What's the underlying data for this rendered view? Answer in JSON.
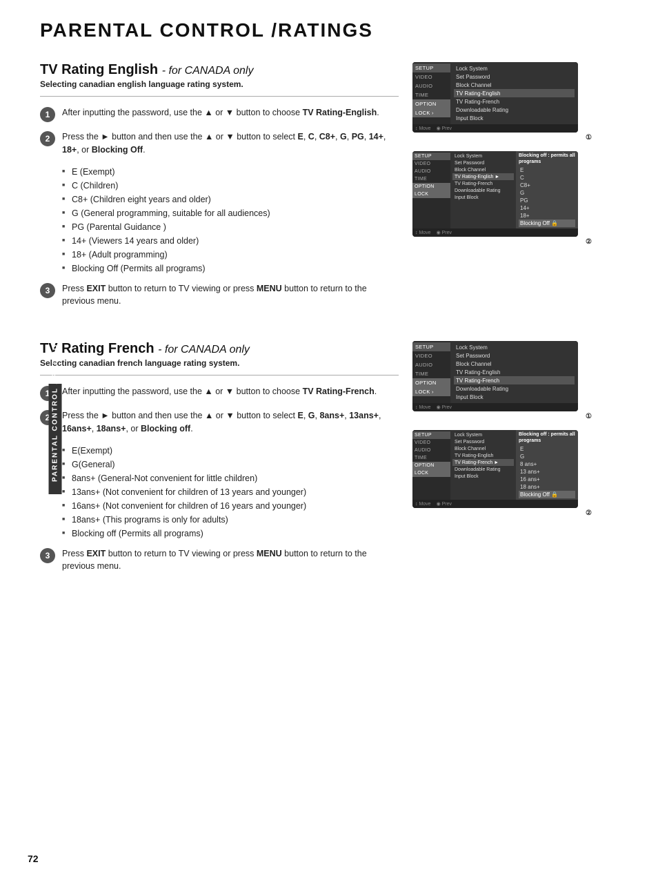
{
  "page": {
    "title": "PARENTAL CONTROL /RATINGS",
    "number": "72",
    "side_tab": "PARENTAL CONTROL / RATING"
  },
  "section1": {
    "title": "TV Rating English",
    "subtitle_italic": "- for CANADA only",
    "subtitle2": "Selecting canadian english language rating system.",
    "steps": [
      {
        "number": "1",
        "text": "After inputting the password, use the ▲ or ▼ button to choose TV Rating-English."
      },
      {
        "number": "2",
        "text": "Press the ► button and then use the ▲ or ▼ button to select E, C, C8+, G, PG, 14+, 18+, or Blocking Off."
      },
      {
        "number": "3",
        "text": "Press EXIT button to return to TV viewing or press MENU button to return to the previous menu."
      }
    ],
    "bullets": [
      "E (Exempt)",
      "C (Children)",
      "C8+ (Children eight years and older)",
      "G (General programming, suitable for all audiences)",
      "PG (Parental Guidance )",
      "14+ (Viewers 14 years and older)",
      "18+ (Adult programming)",
      "Blocking Off (Permits all programs)"
    ],
    "screen1": {
      "sidebar_items": [
        "SETUP",
        "VIDEO",
        "AUDIO",
        "TIME",
        "OPTION",
        "LOCK"
      ],
      "active_sidebar": "LOCK",
      "menu_items": [
        "Lock System",
        "Set Password",
        "Block Channel",
        "TV Rating-English",
        "TV Rating-French",
        "Downloadable Rating",
        "Input Block"
      ],
      "selected_menu": "TV Rating-English",
      "footer": [
        "↕Move",
        "OK Prev"
      ]
    },
    "screen2": {
      "sidebar_items": [
        "SETUP",
        "VIDEO",
        "AUDIO",
        "TIME",
        "OPTION",
        "LOCK"
      ],
      "active_sidebar": "LOCK",
      "menu_items": [
        "Lock System",
        "Set Password",
        "Block Channel",
        "TV Rating-English",
        "TV Rating-French",
        "Downloadable Rating",
        "Input Block"
      ],
      "selected_menu": "TV Rating-English",
      "submenu_title": "Blocking off : permits all programs",
      "submenu_items": [
        "E",
        "C",
        "C8+",
        "G",
        "PG",
        "14+",
        "18+",
        "Blocking Off"
      ],
      "selected_submenu": "Blocking Off",
      "footer": [
        "↕Move",
        "OK Prev"
      ]
    }
  },
  "section2": {
    "title": "TV Rating French",
    "subtitle_italic": "- for CANADA only",
    "subtitle2": "Selecting canadian french language rating system.",
    "steps": [
      {
        "number": "1",
        "text": "After inputting the password, use the ▲ or ▼ button to choose TV Rating-French."
      },
      {
        "number": "2",
        "text": "Press the ► button and then use the ▲ or ▼ button to select E, G, 8ans+, 13ans+, 16ans+, 18ans+, or Blocking off."
      },
      {
        "number": "3",
        "text": "Press EXIT button to return to TV viewing or press MENU button to return to the previous menu."
      }
    ],
    "bullets": [
      "E(Exempt)",
      "G(General)",
      "8ans+ (General-Not convenient for little children)",
      "13ans+ (Not convenient for children of 13 years and younger)",
      "16ans+ (Not convenient for children of 16 years and younger)",
      "18ans+ (This programs is only for adults)",
      "Blocking off (Permits all programs)"
    ],
    "screen1": {
      "sidebar_items": [
        "SETUP",
        "VIDEO",
        "AUDIO",
        "TIME",
        "OPTION",
        "LOCK"
      ],
      "active_sidebar": "LOCK",
      "menu_items": [
        "Lock System",
        "Set Password",
        "Block Channel",
        "TV Rating-English",
        "TV Rating-French",
        "Downloadable Rating",
        "Input Block"
      ],
      "selected_menu": "TV Rating-French",
      "footer": [
        "↕Move",
        "OK Prev"
      ]
    },
    "screen2": {
      "sidebar_items": [
        "SETUP",
        "VIDEO",
        "AUDIO",
        "TIME",
        "OPTION",
        "LOCK"
      ],
      "active_sidebar": "LOCK",
      "menu_items": [
        "Lock System",
        "Set Password",
        "Block Channel",
        "TV Rating-English",
        "TV Rating-French",
        "Downloadable Rating",
        "Input Block"
      ],
      "selected_menu": "TV Rating-French",
      "submenu_title": "Blocking off : permits all programs",
      "submenu_items": [
        "E",
        "G",
        "8 ans+",
        "13 ans+",
        "16 ans+",
        "18 ans+",
        "Blocking Off"
      ],
      "selected_submenu": "Blocking Off",
      "footer": [
        "↕Move",
        "OK Prev"
      ]
    }
  }
}
